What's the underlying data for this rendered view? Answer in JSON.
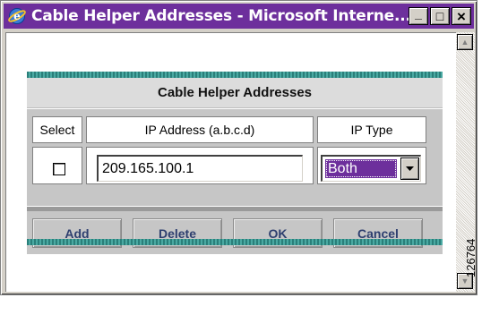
{
  "window": {
    "title": "Cable Helper Addresses - Microsoft Interne...",
    "controls": {
      "minimize": "_",
      "maximize": "□",
      "close": "×"
    },
    "icon": "ie-icon"
  },
  "panel": {
    "title": "Cable Helper Addresses",
    "columns": {
      "select": "Select",
      "ip": "IP Address (a.b.c.d)",
      "type": "IP Type"
    },
    "row": {
      "selected": false,
      "ip_value": "209.165.100.1",
      "ip_type": "Both"
    }
  },
  "buttons": {
    "add": "Add",
    "delete": "Delete",
    "ok": "OK",
    "cancel": "Cancel"
  },
  "figure_id": "126764",
  "colors": {
    "titlebar": "#6d2f9c",
    "teal_bar": "#2a7f7a",
    "button_text": "#2e3f6f",
    "selection": "#6d2f9c"
  }
}
